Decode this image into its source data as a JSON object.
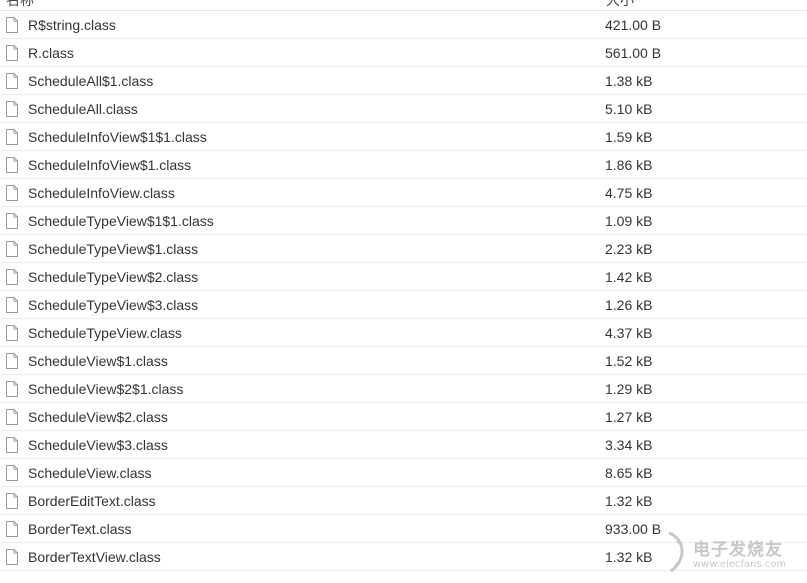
{
  "header": {
    "name_col": "名称",
    "size_col": "大小"
  },
  "files": [
    {
      "name": "R$string.class",
      "size": "421.00 B",
      "icon": "file-icon"
    },
    {
      "name": "R.class",
      "size": "561.00 B",
      "icon": "file-icon"
    },
    {
      "name": "ScheduleAll$1.class",
      "size": "1.38 kB",
      "icon": "file-icon"
    },
    {
      "name": "ScheduleAll.class",
      "size": "5.10 kB",
      "icon": "file-icon"
    },
    {
      "name": "ScheduleInfoView$1$1.class",
      "size": "1.59 kB",
      "icon": "file-icon"
    },
    {
      "name": "ScheduleInfoView$1.class",
      "size": "1.86 kB",
      "icon": "file-icon"
    },
    {
      "name": "ScheduleInfoView.class",
      "size": "4.75 kB",
      "icon": "file-icon"
    },
    {
      "name": "ScheduleTypeView$1$1.class",
      "size": "1.09 kB",
      "icon": "file-icon"
    },
    {
      "name": "ScheduleTypeView$1.class",
      "size": "2.23 kB",
      "icon": "file-icon"
    },
    {
      "name": "ScheduleTypeView$2.class",
      "size": "1.42 kB",
      "icon": "file-icon"
    },
    {
      "name": "ScheduleTypeView$3.class",
      "size": "1.26 kB",
      "icon": "file-icon"
    },
    {
      "name": "ScheduleTypeView.class",
      "size": "4.37 kB",
      "icon": "file-icon"
    },
    {
      "name": "ScheduleView$1.class",
      "size": "1.52 kB",
      "icon": "file-icon"
    },
    {
      "name": "ScheduleView$2$1.class",
      "size": "1.29 kB",
      "icon": "file-icon"
    },
    {
      "name": "ScheduleView$2.class",
      "size": "1.27 kB",
      "icon": "file-icon"
    },
    {
      "name": "ScheduleView$3.class",
      "size": "3.34 kB",
      "icon": "file-icon"
    },
    {
      "name": "ScheduleView.class",
      "size": "8.65 kB",
      "icon": "file-icon"
    },
    {
      "name": "BorderEditText.class",
      "size": "1.32 kB",
      "icon": "file-icon"
    },
    {
      "name": "BorderText.class",
      "size": "933.00 B",
      "icon": "file-icon"
    },
    {
      "name": "BorderTextView.class",
      "size": "1.32 kB",
      "icon": "file-icon"
    }
  ],
  "watermark": {
    "text": "电子发烧友",
    "url": "www.elecfans.com"
  },
  "colors": {
    "text": "#333333",
    "row_border": "#ececec",
    "icon_stroke": "#9a9a9a"
  }
}
